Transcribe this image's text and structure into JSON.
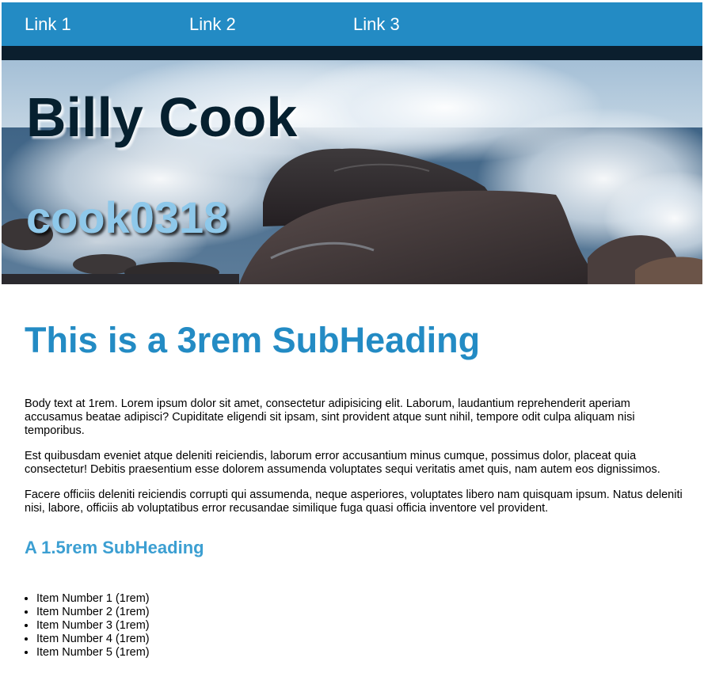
{
  "nav": {
    "links": [
      {
        "label": "Link 1"
      },
      {
        "label": "Link 2"
      },
      {
        "label": "Link 3"
      }
    ],
    "background": "#238bc4",
    "strip_color": "#0b1f2e"
  },
  "hero": {
    "title": "Billy Cook",
    "subtitle": "cook0318",
    "title_color": "#06202f",
    "subtitle_color": "#8ec8ea",
    "image": "ocean waves crashing on rocks"
  },
  "main": {
    "heading": "This is a 3rem SubHeading",
    "paragraphs": [
      "Body text at 1rem. Lorem ipsum dolor sit amet, consectetur adipisicing elit. Laborum, laudantium reprehenderit aperiam accusamus beatae adipisci? Cupiditate eligendi sit ipsam, sint provident atque sunt nihil, tempore odit culpa aliquam nisi temporibus.",
      "Est quibusdam eveniet atque deleniti reiciendis, laborum error accusantium minus cumque, possimus dolor, placeat quia consectetur! Debitis praesentium esse dolorem assumenda voluptates sequi veritatis amet quis, nam autem eos dignissimos.",
      "Facere officiis deleniti reiciendis corrupti qui assumenda, neque asperiores, voluptates libero nam quisquam ipsum. Natus deleniti nisi, labore, officiis ab voluptatibus error recusandae similique fuga quasi officia inventore vel provident."
    ],
    "subheading": "A 1.5rem SubHeading",
    "list_items": [
      "Item Number 1 (1rem)",
      "Item Number 2 (1rem)",
      "Item Number 3 (1rem)",
      "Item Number 4 (1rem)",
      "Item Number 5 (1rem)"
    ],
    "heading_color": "#238bc4",
    "subheading_color": "#3c9fd2"
  }
}
